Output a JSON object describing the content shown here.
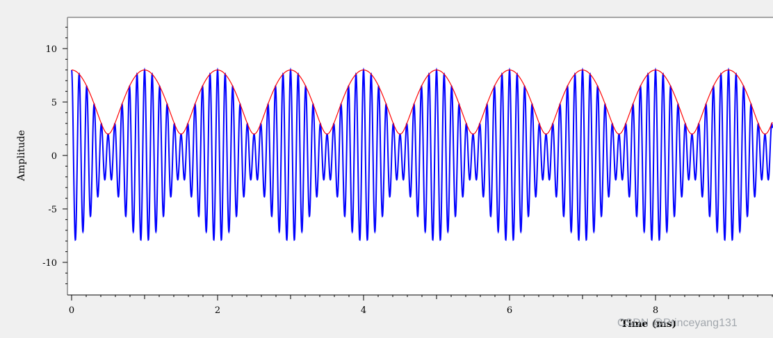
{
  "chart_data": {
    "type": "line",
    "title": "",
    "xlabel": "Time (ms)",
    "ylabel": "Amplitude",
    "xlim": [
      0,
      9.6
    ],
    "ylim": [
      -12.5,
      12.5
    ],
    "x_ticks": [
      0,
      2,
      4,
      6,
      8
    ],
    "y_ticks": [
      -10,
      -5,
      0,
      5,
      10
    ],
    "grid": false,
    "series": [
      {
        "color": "#0000ff",
        "signal": "3*cos(2*pi*9*t) + 5*cos(2*pi*10*t), t in ms",
        "x_range": [
          0,
          9.6
        ],
        "y_range": [
          -6.8,
          8
        ]
      },
      {
        "color": "#ff0000",
        "signal": "amplitude envelope of the blue signal: sqrt(34 + 30*cos(2*pi*1*t))",
        "x_range": [
          0,
          9.6
        ],
        "y_range": [
          3.8,
          8
        ]
      }
    ]
  },
  "watermark": "CSDN @Princeyang131"
}
